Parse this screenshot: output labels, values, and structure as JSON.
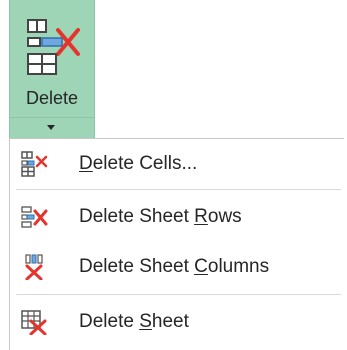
{
  "ribbon": {
    "label": "Delete",
    "icon": "delete-cells-icon",
    "accent_color": "#9fd5b7",
    "x_color": "#e4342c"
  },
  "menu": {
    "items": [
      {
        "pre": "",
        "accel": "D",
        "post": "elete Cells...",
        "icon": "delete-cells-icon"
      },
      {
        "pre": "Delete Sheet ",
        "accel": "R",
        "post": "ows",
        "icon": "delete-sheet-rows-icon"
      },
      {
        "pre": "Delete Sheet ",
        "accel": "C",
        "post": "olumns",
        "icon": "delete-sheet-columns-icon"
      },
      {
        "pre": "Delete ",
        "accel": "S",
        "post": "heet",
        "icon": "delete-sheet-icon"
      }
    ]
  }
}
